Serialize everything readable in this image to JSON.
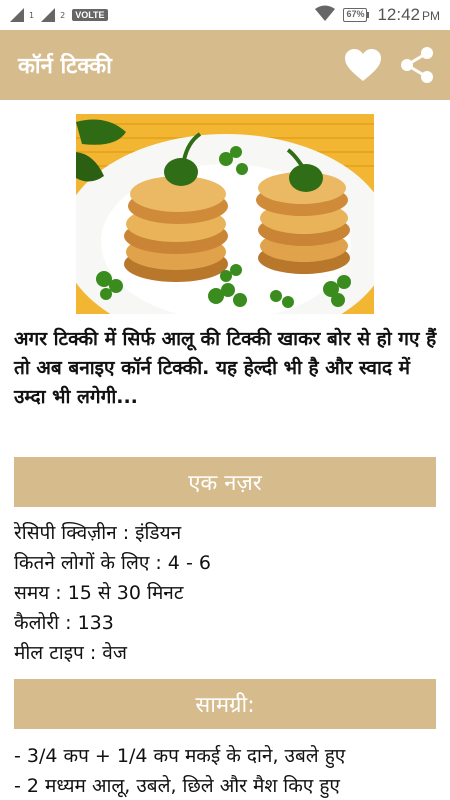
{
  "status_bar": {
    "sim1": "1",
    "sim2": "2",
    "volte": "VOLTE",
    "battery": "67%",
    "time": "12:42",
    "ampm": "PM"
  },
  "app_bar": {
    "title": "कॉर्न टिक्की",
    "favorite_icon": "heart-icon",
    "share_icon": "share-icon"
  },
  "intro": "अगर टिक्की में सिर्फ आलू की टिक्की खाकर बोर से हो गए हैं तो अब बनाइए कॉर्न टिक्की. यह हेल्दी भी है और स्वाद में उम्दा भी लगेगी...",
  "overview": {
    "heading": "एक नज़र",
    "rows": [
      "रेसिपी क्विज़ीन : इंडियन",
      "कितने लोगों के लिए : 4 - 6",
      "समय : 15 से 30 मिनट",
      "कैलोरी : 133",
      "मील टाइप : वेज"
    ]
  },
  "ingredients": {
    "heading": "सामग्री:",
    "items": [
      "- 3/4 कप + 1/4 कप मकई के दाने, उबले हुए",
      "- 2 मध्यम आलू, उबले, छिले और मैश किए हुए"
    ]
  },
  "colors": {
    "accent": "#d6bc8d",
    "text": "#111111"
  }
}
